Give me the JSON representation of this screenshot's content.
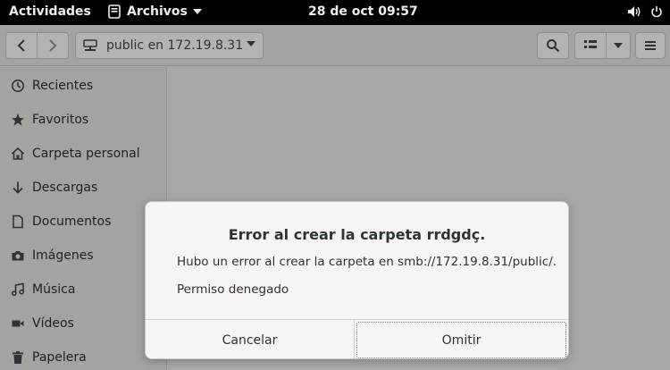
{
  "topbar": {
    "activities": "Actividades",
    "app_menu": "Archivos",
    "clock": "28 de oct  09:57"
  },
  "header": {
    "location": "public en 172.19.8.31"
  },
  "sidebar": {
    "items": [
      {
        "label": "Recientes",
        "icon": "clock-icon"
      },
      {
        "label": "Favoritos",
        "icon": "star-icon"
      },
      {
        "label": "Carpeta personal",
        "icon": "home-icon"
      },
      {
        "label": "Descargas",
        "icon": "download-icon"
      },
      {
        "label": "Documentos",
        "icon": "document-icon"
      },
      {
        "label": "Imágenes",
        "icon": "camera-icon"
      },
      {
        "label": "Música",
        "icon": "music-icon"
      },
      {
        "label": "Vídeos",
        "icon": "video-icon"
      },
      {
        "label": "Papelera",
        "icon": "trash-icon"
      }
    ]
  },
  "dialog": {
    "title": "Error al crear la carpeta rrdgdç.",
    "message": "Hubo un error al crear la carpeta en smb://172.19.8.31/public/.",
    "secondary": "Permiso denegado",
    "cancel_label": "Cancelar",
    "omit_label": "Omitir"
  }
}
